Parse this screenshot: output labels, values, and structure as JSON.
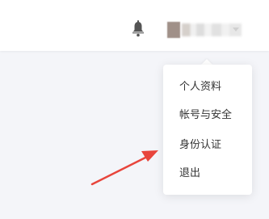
{
  "header": {
    "icons": [
      "bell-icon",
      "chevron-down-icon"
    ]
  },
  "user_menu": {
    "items": [
      {
        "label": "个人资料"
      },
      {
        "label": "帐号与安全"
      },
      {
        "label": "身份认证"
      },
      {
        "label": "退出"
      }
    ]
  },
  "colors": {
    "page_background": "#f4f5f9",
    "header_background": "#ffffff",
    "menu_text": "#333333",
    "annotation_arrow": "#e8453c"
  }
}
